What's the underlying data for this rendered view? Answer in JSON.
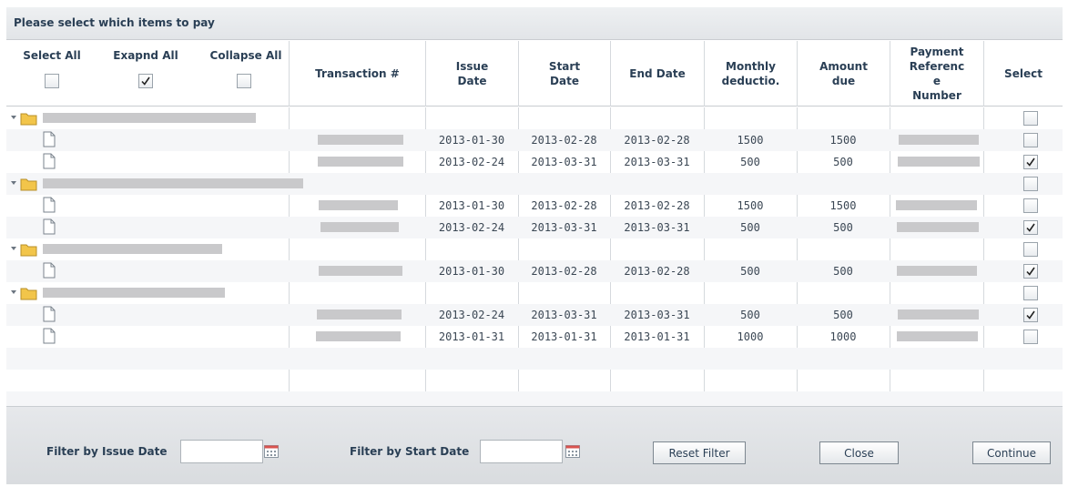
{
  "dialog": {
    "title": "Please select which items to pay"
  },
  "header": {
    "select_all": "Select All",
    "expand_all": "Exapnd All",
    "collapse_all": "Collapse All",
    "select_all_checked": false,
    "expand_all_checked": true,
    "collapse_all_checked": false,
    "columns": {
      "transaction": "Transaction #",
      "issue_date": "Issue Date",
      "start_date": "Start Date",
      "end_date": "End Date",
      "monthly_deduction": "Monthly deductio.",
      "amount_due": "Amount due",
      "payment_reference": "Payment Referenc e Number",
      "select": "Select"
    }
  },
  "rows": [
    {
      "type": "group",
      "selected": false
    },
    {
      "type": "item",
      "issue": "2013-01-30",
      "start": "2013-02-28",
      "end": "2013-02-28",
      "monthly": "1500",
      "amount": "1500",
      "selected": false
    },
    {
      "type": "item",
      "issue": "2013-02-24",
      "start": "2013-03-31",
      "end": "2013-03-31",
      "monthly": "500",
      "amount": "500",
      "selected": true
    },
    {
      "type": "group",
      "selected": false
    },
    {
      "type": "item",
      "issue": "2013-01-30",
      "start": "2013-02-28",
      "end": "2013-02-28",
      "monthly": "1500",
      "amount": "1500",
      "selected": false
    },
    {
      "type": "item",
      "issue": "2013-02-24",
      "start": "2013-03-31",
      "end": "2013-03-31",
      "monthly": "500",
      "amount": "500",
      "selected": true
    },
    {
      "type": "group",
      "selected": false
    },
    {
      "type": "item",
      "issue": "2013-01-30",
      "start": "2013-02-28",
      "end": "2013-02-28",
      "monthly": "500",
      "amount": "500",
      "selected": true
    },
    {
      "type": "group",
      "selected": false
    },
    {
      "type": "item",
      "issue": "2013-02-24",
      "start": "2013-03-31",
      "end": "2013-03-31",
      "monthly": "500",
      "amount": "500",
      "selected": true
    },
    {
      "type": "item",
      "issue": "2013-01-31",
      "start": "2013-01-31",
      "end": "2013-01-31",
      "monthly": "1000",
      "amount": "1000",
      "selected": false
    }
  ],
  "footer": {
    "filter_issue_label": "Filter by Issue Date",
    "filter_issue_value": "",
    "filter_start_label": "Filter by Start Date",
    "filter_start_value": "",
    "reset_label": "Reset Filter",
    "close_label": "Close",
    "continue_label": "Continue"
  },
  "icons": {
    "expand": "triangle-down-icon",
    "folder": "folder-icon",
    "document": "document-icon",
    "calendar": "calendar-icon",
    "checkmark": "checkmark-icon"
  },
  "colors": {
    "title_text": "#2a3f55",
    "folder": "#f2c54a",
    "redacted": "#c9c9cb"
  }
}
